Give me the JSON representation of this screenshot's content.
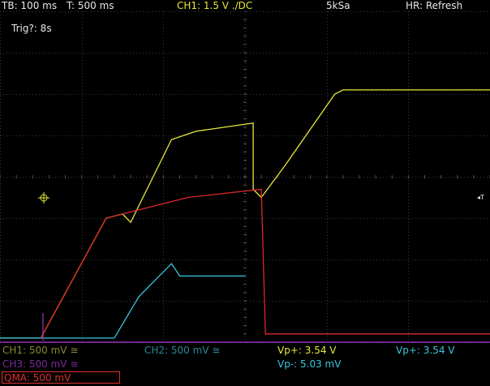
{
  "header": {
    "timebase": "TB: 100 ms",
    "trigger_time": "T: 500 ms",
    "channel1": "CH1: 1.5 V ./DC",
    "sample_rate": "5kSa",
    "mode": "HR: Refresh"
  },
  "trigger_status": "Trig?: 8s",
  "footer": {
    "ch1": "CH1: 500 mV ≅",
    "ch2": "CH2: 500 mV ≅",
    "ch3": "CH3: 500 mV ≅",
    "qma": "QMA: 500 mV",
    "vp_plus_a": "Vp+: 3.54 V",
    "vp_minus": "Vp-: 5.03 mV",
    "vp_plus_b": "Vp+: 3.54 V"
  },
  "colors": {
    "ch1": "#e8e83a",
    "ch2": "#39c8de",
    "ch3": "#b03ad8",
    "qma": "#e02828",
    "grid": "#3a3a3a"
  },
  "chart_data": {
    "type": "line",
    "grid": true,
    "series": [
      {
        "name": "CH1",
        "points": [
          [
            0,
            -3.9
          ],
          [
            0.5,
            -3.9
          ],
          [
            1.3,
            -1.0
          ],
          [
            1.5,
            -0.9
          ],
          [
            1.6,
            -1.1
          ],
          [
            2.1,
            0.9
          ],
          [
            2.4,
            1.1
          ],
          [
            3.1,
            1.3
          ],
          [
            3.1,
            -0.3
          ],
          [
            3.2,
            -0.5
          ],
          [
            3.5,
            0.3
          ],
          [
            4.1,
            2.0
          ],
          [
            4.2,
            2.1
          ],
          [
            6.2,
            2.1
          ]
        ]
      },
      {
        "name": "CH2",
        "points": [
          [
            0,
            -3.9
          ],
          [
            1.4,
            -3.9
          ],
          [
            1.7,
            -2.9
          ],
          [
            2.1,
            -2.1
          ],
          [
            2.2,
            -2.4
          ],
          [
            3.0,
            -2.4
          ]
        ]
      },
      {
        "name": "CH3",
        "points": [
          [
            0,
            -4.0
          ],
          [
            6.2,
            -4.0
          ]
        ]
      },
      {
        "name": "QMA",
        "points": [
          [
            0.5,
            -3.9
          ],
          [
            1.3,
            -1.0
          ],
          [
            1.7,
            -0.8
          ],
          [
            2.1,
            -0.6
          ],
          [
            2.3,
            -0.5
          ],
          [
            3.2,
            -0.3
          ],
          [
            3.25,
            -3.8
          ],
          [
            6.2,
            -3.8
          ]
        ]
      }
    ]
  }
}
